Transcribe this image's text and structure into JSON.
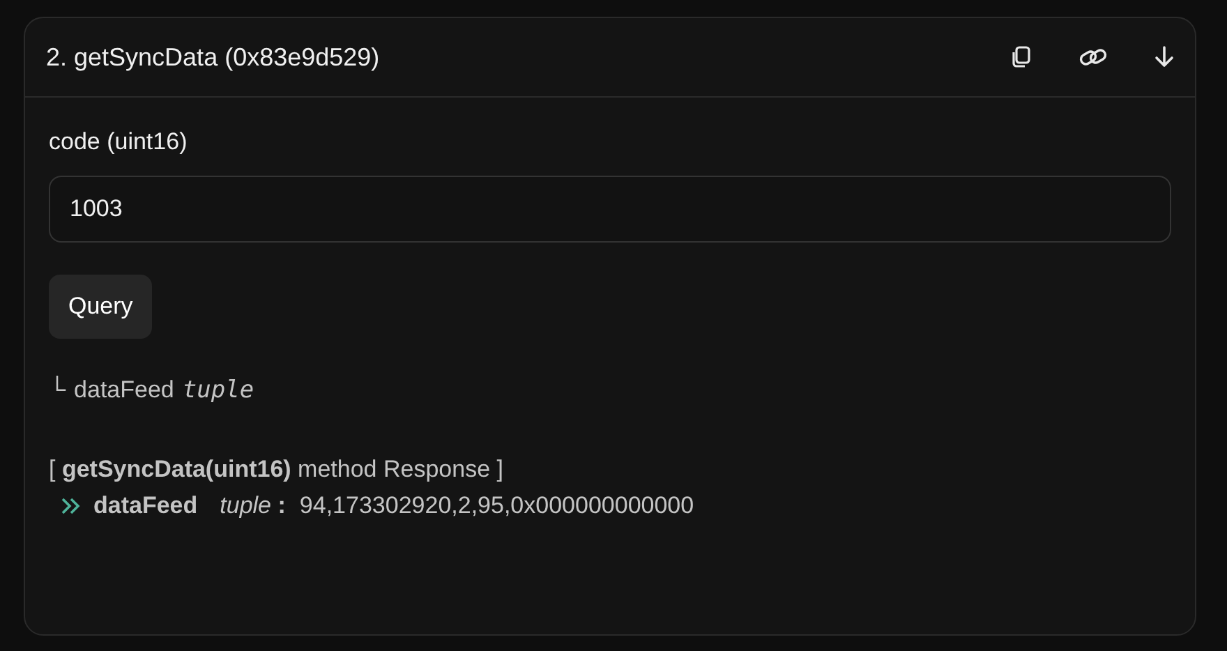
{
  "card": {
    "title": "2. getSyncData (0x83e9d529)"
  },
  "inputs": [
    {
      "label": "code (uint16)",
      "value": "1003"
    }
  ],
  "query_button": "Query",
  "outputs": [
    {
      "branch": "└",
      "name": "dataFeed",
      "type": "tuple"
    }
  ],
  "response": {
    "heading": "[ **getSyncData(uint16)** method Response ]",
    "items": [
      {
        "name": "dataFeed",
        "type": "*tuple* **:**",
        "value": "94,173302920,2,95,0x000000000000"
      }
    ]
  }
}
